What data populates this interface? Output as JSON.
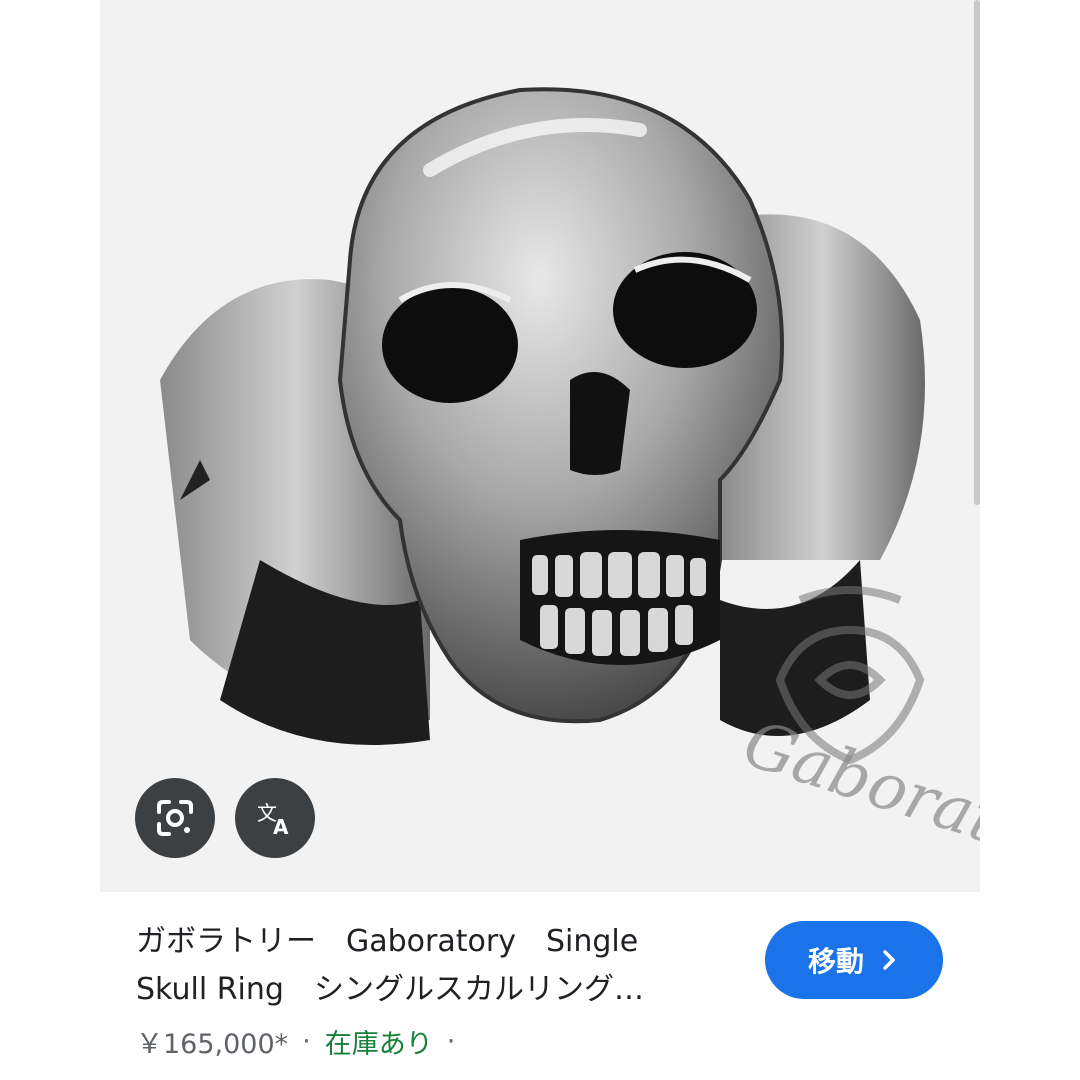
{
  "image": {
    "description_icon": "skull-ring-photo",
    "watermark_text": "Gaboratory"
  },
  "actions": {
    "lens_icon": "google-lens-icon",
    "translate_icon": "translate-icon"
  },
  "result": {
    "title": "ガボラトリー　Gaboratory　Single　Skull Ring　シングルスカルリング…",
    "price": "￥165,000*",
    "separator": "·",
    "stock": "在庫あり",
    "trailing_separator": "·"
  },
  "visit_button": {
    "label": "移動",
    "icon": "chevron-right-icon"
  },
  "colors": {
    "accent": "#1a73e8",
    "stock": "#188038",
    "fab_bg": "#3c4043"
  }
}
